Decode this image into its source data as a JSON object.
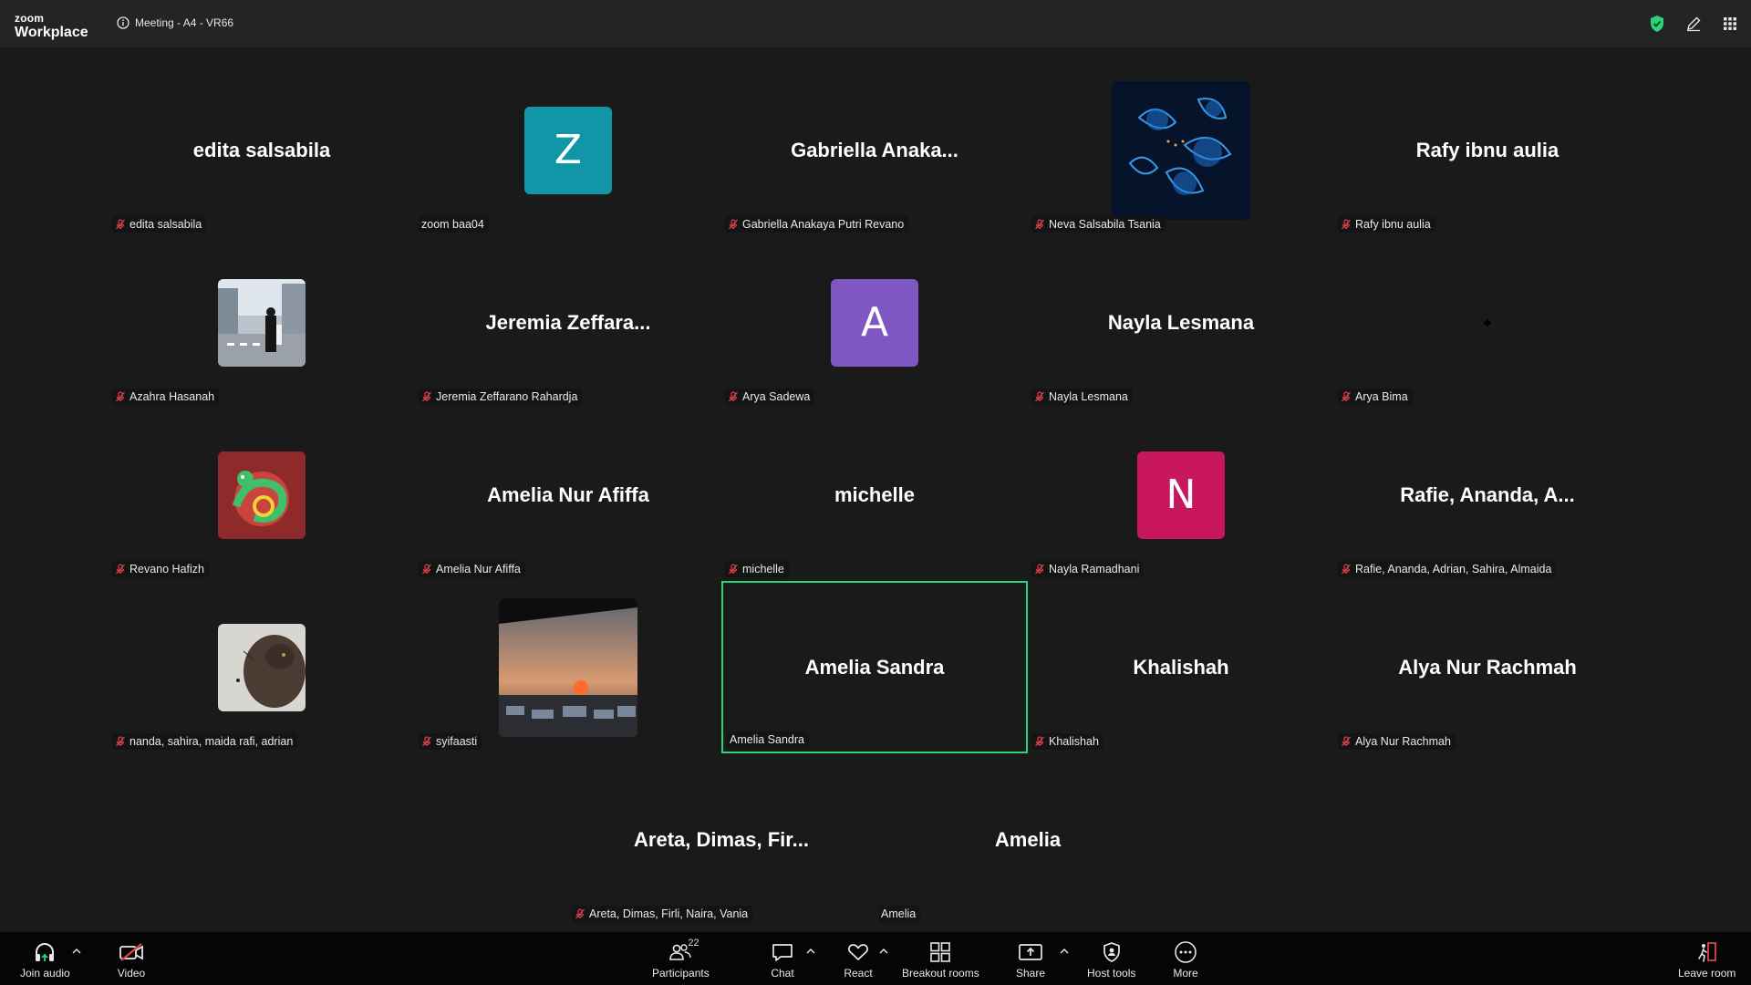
{
  "app": {
    "logo_small": "zoom",
    "logo_big": "Workplace",
    "meeting_title": "Meeting - A4 - VR66"
  },
  "colors": {
    "background": "#1a1a1a",
    "topbar": "#242424",
    "toolbar": "#050505",
    "active_speaker_border": "#2bd47a",
    "muted_mic": "#e0414b",
    "shield": "#2bd47a"
  },
  "participants": [
    {
      "display": "edita salsabila",
      "label": "edita salsabila",
      "muted": true,
      "kind": "name"
    },
    {
      "display": "Z",
      "label": "zoom baa04",
      "muted": false,
      "kind": "letter",
      "color": "#1196a8"
    },
    {
      "display": "Gabriella  Anaka...",
      "label": "Gabriella Anakaya Putri Revano",
      "muted": true,
      "kind": "name"
    },
    {
      "display": "",
      "label": "Neva Salsabila Tsania",
      "muted": true,
      "kind": "photo-flower"
    },
    {
      "display": "Rafy ibnu aulia",
      "label": "Rafy ibnu aulia",
      "muted": true,
      "kind": "name"
    },
    {
      "display": "",
      "label": "Azahra Hasanah",
      "muted": true,
      "kind": "photo-street"
    },
    {
      "display": "Jeremia  Zeffara...",
      "label": "Jeremia Zeffarano Rahardja",
      "muted": true,
      "kind": "name"
    },
    {
      "display": "A",
      "label": "Arya Sadewa",
      "muted": true,
      "kind": "letter",
      "color": "#7e57c2"
    },
    {
      "display": "Nayla Lesmana",
      "label": "Nayla Lesmana",
      "muted": true,
      "kind": "name"
    },
    {
      "display": "",
      "label": "Arya Bima",
      "muted": true,
      "kind": "dot"
    },
    {
      "display": "",
      "label": "Revano Hafizh",
      "muted": true,
      "kind": "photo-dragon"
    },
    {
      "display": "Amelia Nur Afiffa",
      "label": "Amelia Nur Afiffa",
      "muted": true,
      "kind": "name"
    },
    {
      "display": "michelle",
      "label": "michelle",
      "muted": true,
      "kind": "name"
    },
    {
      "display": "N",
      "label": "Nayla Ramadhani",
      "muted": true,
      "kind": "letter",
      "color": "#c8175f"
    },
    {
      "display": "Rafie,  Ananda,  A...",
      "label": "Rafie, Ananda, Adrian, Sahira, Almaida",
      "muted": true,
      "kind": "name"
    },
    {
      "display": "",
      "label": "nanda, sahira, maida rafi, adrian",
      "muted": true,
      "kind": "photo-cat"
    },
    {
      "display": "",
      "label": "syifaasti",
      "muted": true,
      "kind": "photo-sunset"
    },
    {
      "display": "Amelia Sandra",
      "label": "Amelia Sandra",
      "muted": false,
      "kind": "name",
      "active": true
    },
    {
      "display": "Khalishah",
      "label": "Khalishah",
      "muted": true,
      "kind": "name"
    },
    {
      "display": "Alya Nur Rachmah",
      "label": "Alya Nur Rachmah",
      "muted": true,
      "kind": "name"
    },
    {
      "display": "Areta,  Dimas,  Fir...",
      "label": "Areta, Dimas, Firli, Naira, Vania",
      "muted": true,
      "kind": "name"
    },
    {
      "display": "Amelia",
      "label": "Amelia",
      "muted": false,
      "kind": "name"
    }
  ],
  "toolbar": {
    "join_audio": "Join audio",
    "video": "Video",
    "participants": "Participants",
    "participants_count": "22",
    "chat": "Chat",
    "react": "React",
    "breakout_rooms": "Breakout rooms",
    "share": "Share",
    "host_tools": "Host tools",
    "more": "More",
    "leave_room": "Leave room"
  }
}
